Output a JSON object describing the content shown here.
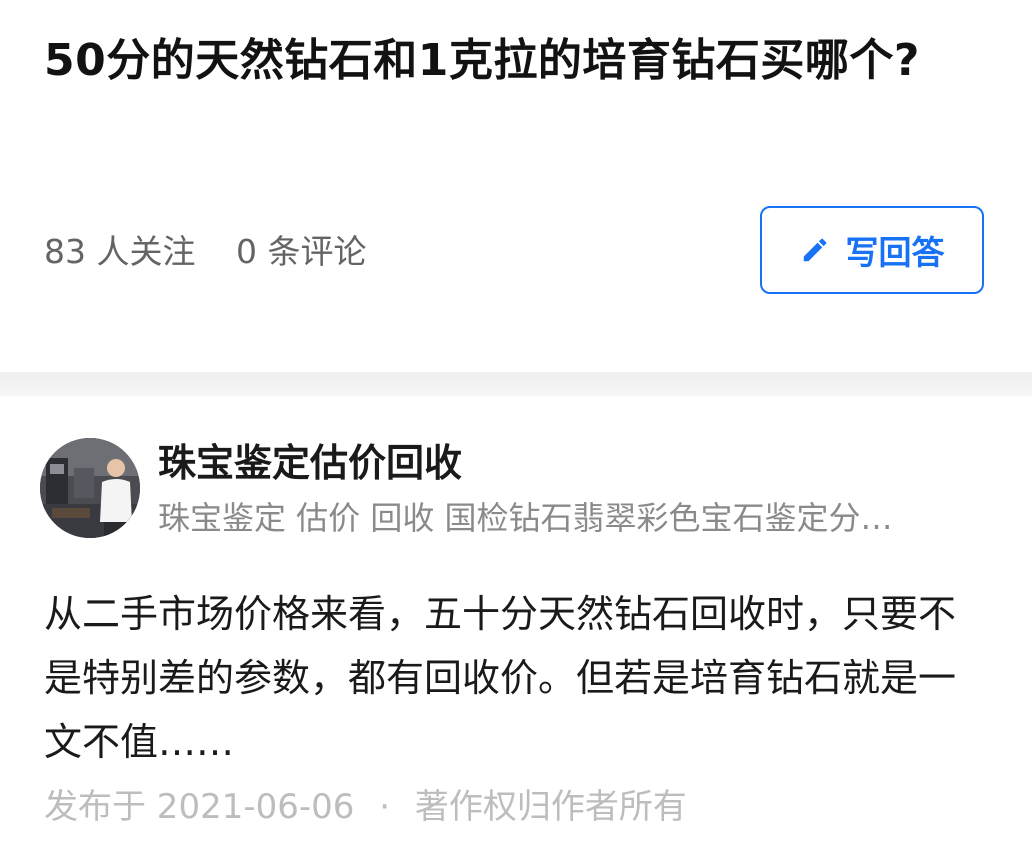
{
  "question": {
    "title": "50分的天然钻石和1克拉的培育钻石买哪个?",
    "followers": "83 人关注",
    "comments": "0 条评论",
    "write_answer_label": "写回答",
    "write_answer_icon": "pencil-icon"
  },
  "answer": {
    "author_name": "珠宝鉴定估价回收",
    "author_bio": "珠宝鉴定 估价 回收 国检钻石翡翠彩色宝石鉴定分…",
    "excerpt": "从二手市场价格来看，五十分天然钻石回收时，只要不是特别差的参数，都有回收价。但若是培育钻石就是一文不值……",
    "published": "发布于 2021-06-06",
    "separator": "·",
    "copyright": "著作权归作者所有"
  },
  "colors": {
    "accent": "#1772f6",
    "title": "#121212",
    "meta": "#646464",
    "muted": "#bdbdbd"
  }
}
